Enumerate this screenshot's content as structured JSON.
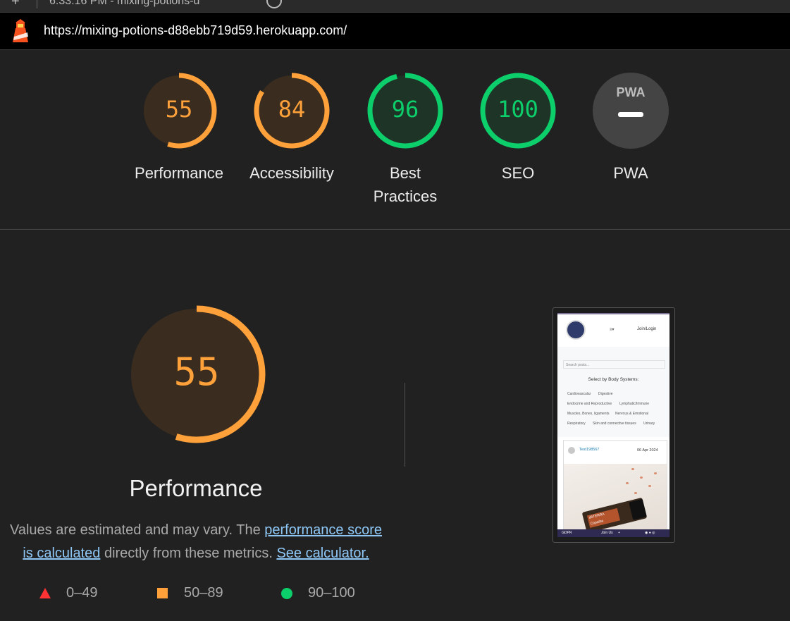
{
  "browser": {
    "tab_title": "6:33:16 PM - mixing-potions-d",
    "url": "https://mixing-potions-d88ebb719d59.herokuapp.com/"
  },
  "gauges": [
    {
      "label": "Performance",
      "score": "55",
      "fraction": 0.55,
      "color": "#ffa13a",
      "bg": "#3a2d1f"
    },
    {
      "label": "Accessibility",
      "score": "84",
      "fraction": 0.84,
      "color": "#ffa13a",
      "bg": "#3a2d1f"
    },
    {
      "label": "Best Practices",
      "score": "96",
      "fraction": 0.96,
      "color": "#0cce6b",
      "bg": "#1e3426"
    },
    {
      "label": "SEO",
      "score": "100",
      "fraction": 1.0,
      "color": "#0cce6b",
      "bg": "#1e3426"
    }
  ],
  "pwa": {
    "label": "PWA",
    "badge_text": "PWA"
  },
  "performance": {
    "score": "55",
    "fraction": 0.55,
    "title": "Performance",
    "desc_prefix": "Values are estimated and may vary. The ",
    "link_score": "performance score is calculated",
    "desc_middle": " directly from these metrics. ",
    "link_calc": "See calculator."
  },
  "legend": [
    {
      "range": "0–49",
      "shape": "triangle",
      "color": "#ff3333"
    },
    {
      "range": "50–89",
      "shape": "square",
      "color": "#ffa13a"
    },
    {
      "range": "90–100",
      "shape": "circle",
      "color": "#0cce6b"
    }
  ],
  "screenshot": {
    "brand": "Mixing potions",
    "join": "Join/Login",
    "search_placeholder": "Search posts...",
    "select_heading": "Select by Body Systems:",
    "systems": [
      "Cardiovascular",
      "Digestive",
      "Endocrine and Reproductive",
      "Lymphatic/Immune",
      "Muscles, Bones, ligaments",
      "Nervous & Emotional",
      "Respiratory",
      "Skin and connective tissues",
      "Urinary"
    ],
    "post_user": "Test198567",
    "post_date": "06 Apr 2024",
    "product_brand": "dōTERRA",
    "product_name": "Copaiba",
    "footer_gdpr": "GDPR",
    "footer_join": "Join Us"
  }
}
